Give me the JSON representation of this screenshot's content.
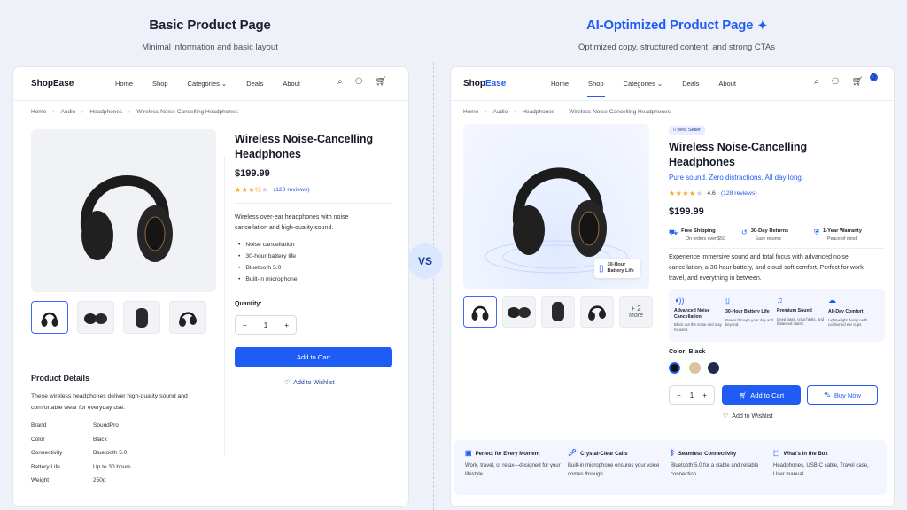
{
  "left": {
    "heading": "Basic Product Page",
    "subheading": "Minimal information and basic layout",
    "logo": "ShopEase",
    "nav": [
      "Home",
      "Shop",
      "Categories ⌄",
      "Deals",
      "About"
    ],
    "breadcrumb": [
      "Home",
      "Audio",
      "Headphones",
      "Wireless Noise-Cancelling Headphones"
    ],
    "title": "Wireless Noise-Cancelling Headphones",
    "price": "$199.99",
    "stars": "★★★½",
    "reviews": "(128 reviews)",
    "description": "Wireless over-ear headphones with noise cancellation and high-quality sound.",
    "features": [
      "Noise cancellation",
      "30-hour battery life",
      "Bluetooth 5.0",
      "Built-in microphone"
    ],
    "quantity_label": "Quantity:",
    "quantity": "1",
    "add_to_cart": "Add to Cart",
    "wishlist": "Add to Wishlist",
    "details_heading": "Product Details",
    "details_text": "These wireless headphones deliver high-quality sound and comfortable wear for everyday use.",
    "specs": [
      {
        "k": "Brand",
        "v": "SoundPro"
      },
      {
        "k": "Color",
        "v": "Black"
      },
      {
        "k": "Connectivity",
        "v": "Bluetooth 5.0"
      },
      {
        "k": "Battery Life",
        "v": "Up to 30 hours"
      },
      {
        "k": "Weight",
        "v": "250g"
      }
    ]
  },
  "vs": "VS",
  "right": {
    "heading": "AI-Optimized Product Page",
    "subheading": "Optimized copy, structured content, and strong CTAs",
    "logo_a": "Shop",
    "logo_b": "Ease",
    "nav": [
      "Home",
      "Shop",
      "Categories ⌄",
      "Deals",
      "About"
    ],
    "cart_count": "0",
    "breadcrumb": [
      "Home",
      "Audio",
      "Headphones",
      "Wireless Noise-Cancelling Headphones"
    ],
    "badge": "Best Seller",
    "title": "Wireless Noise-Cancelling Headphones",
    "tagline": "Pure sound. Zero distractions. All day long.",
    "rating": "4.6",
    "reviews": "(128 reviews)",
    "price": "$199.99",
    "benefits": [
      {
        "t": "Free Shipping",
        "s": "On orders over $50"
      },
      {
        "t": "30-Day Returns",
        "s": "Easy returns"
      },
      {
        "t": "1-Year Warranty",
        "s": "Peace of mind"
      }
    ],
    "description": "Experience immersive sound and total focus with advanced noise cancellation, a 30-hour battery, and cloud-soft comfort. Perfect for work, travel, and everything in between.",
    "features": [
      {
        "t": "Advanced Noise Cancellation",
        "s": "Block out the noise and stay focused."
      },
      {
        "t": "30-Hour Battery Life",
        "s": "Power through your day and beyond."
      },
      {
        "t": "Premium Sound",
        "s": "Deep bass, crisp highs, and balanced clarity."
      },
      {
        "t": "All-Day Comfort",
        "s": "Lightweight design with cushioned ear cups."
      }
    ],
    "battery_tag": "30-Hour Battery Life",
    "more_thumbs": "+ 2",
    "more_label": "More",
    "color_label": "Color: Black",
    "colors": [
      "#111111",
      "#d9c4a0",
      "#1f2b4d"
    ],
    "quantity": "1",
    "add_to_cart": "Add to Cart",
    "buy_now": "Buy Now",
    "wishlist": "Add to Wishlist",
    "footer": [
      {
        "t": "Perfect for Every Moment",
        "s": "Work, travel, or relax—designed for your lifestyle."
      },
      {
        "t": "Crystal-Clear Calls",
        "s": "Built-in microphone ensures your voice comes through."
      },
      {
        "t": "Seamless Connectivity",
        "s": "Bluetooth 5.0 for a stable and reliable connection."
      },
      {
        "t": "What's in the Box",
        "s": "Headphones, USB-C cable, Travel case, User manual"
      }
    ]
  }
}
